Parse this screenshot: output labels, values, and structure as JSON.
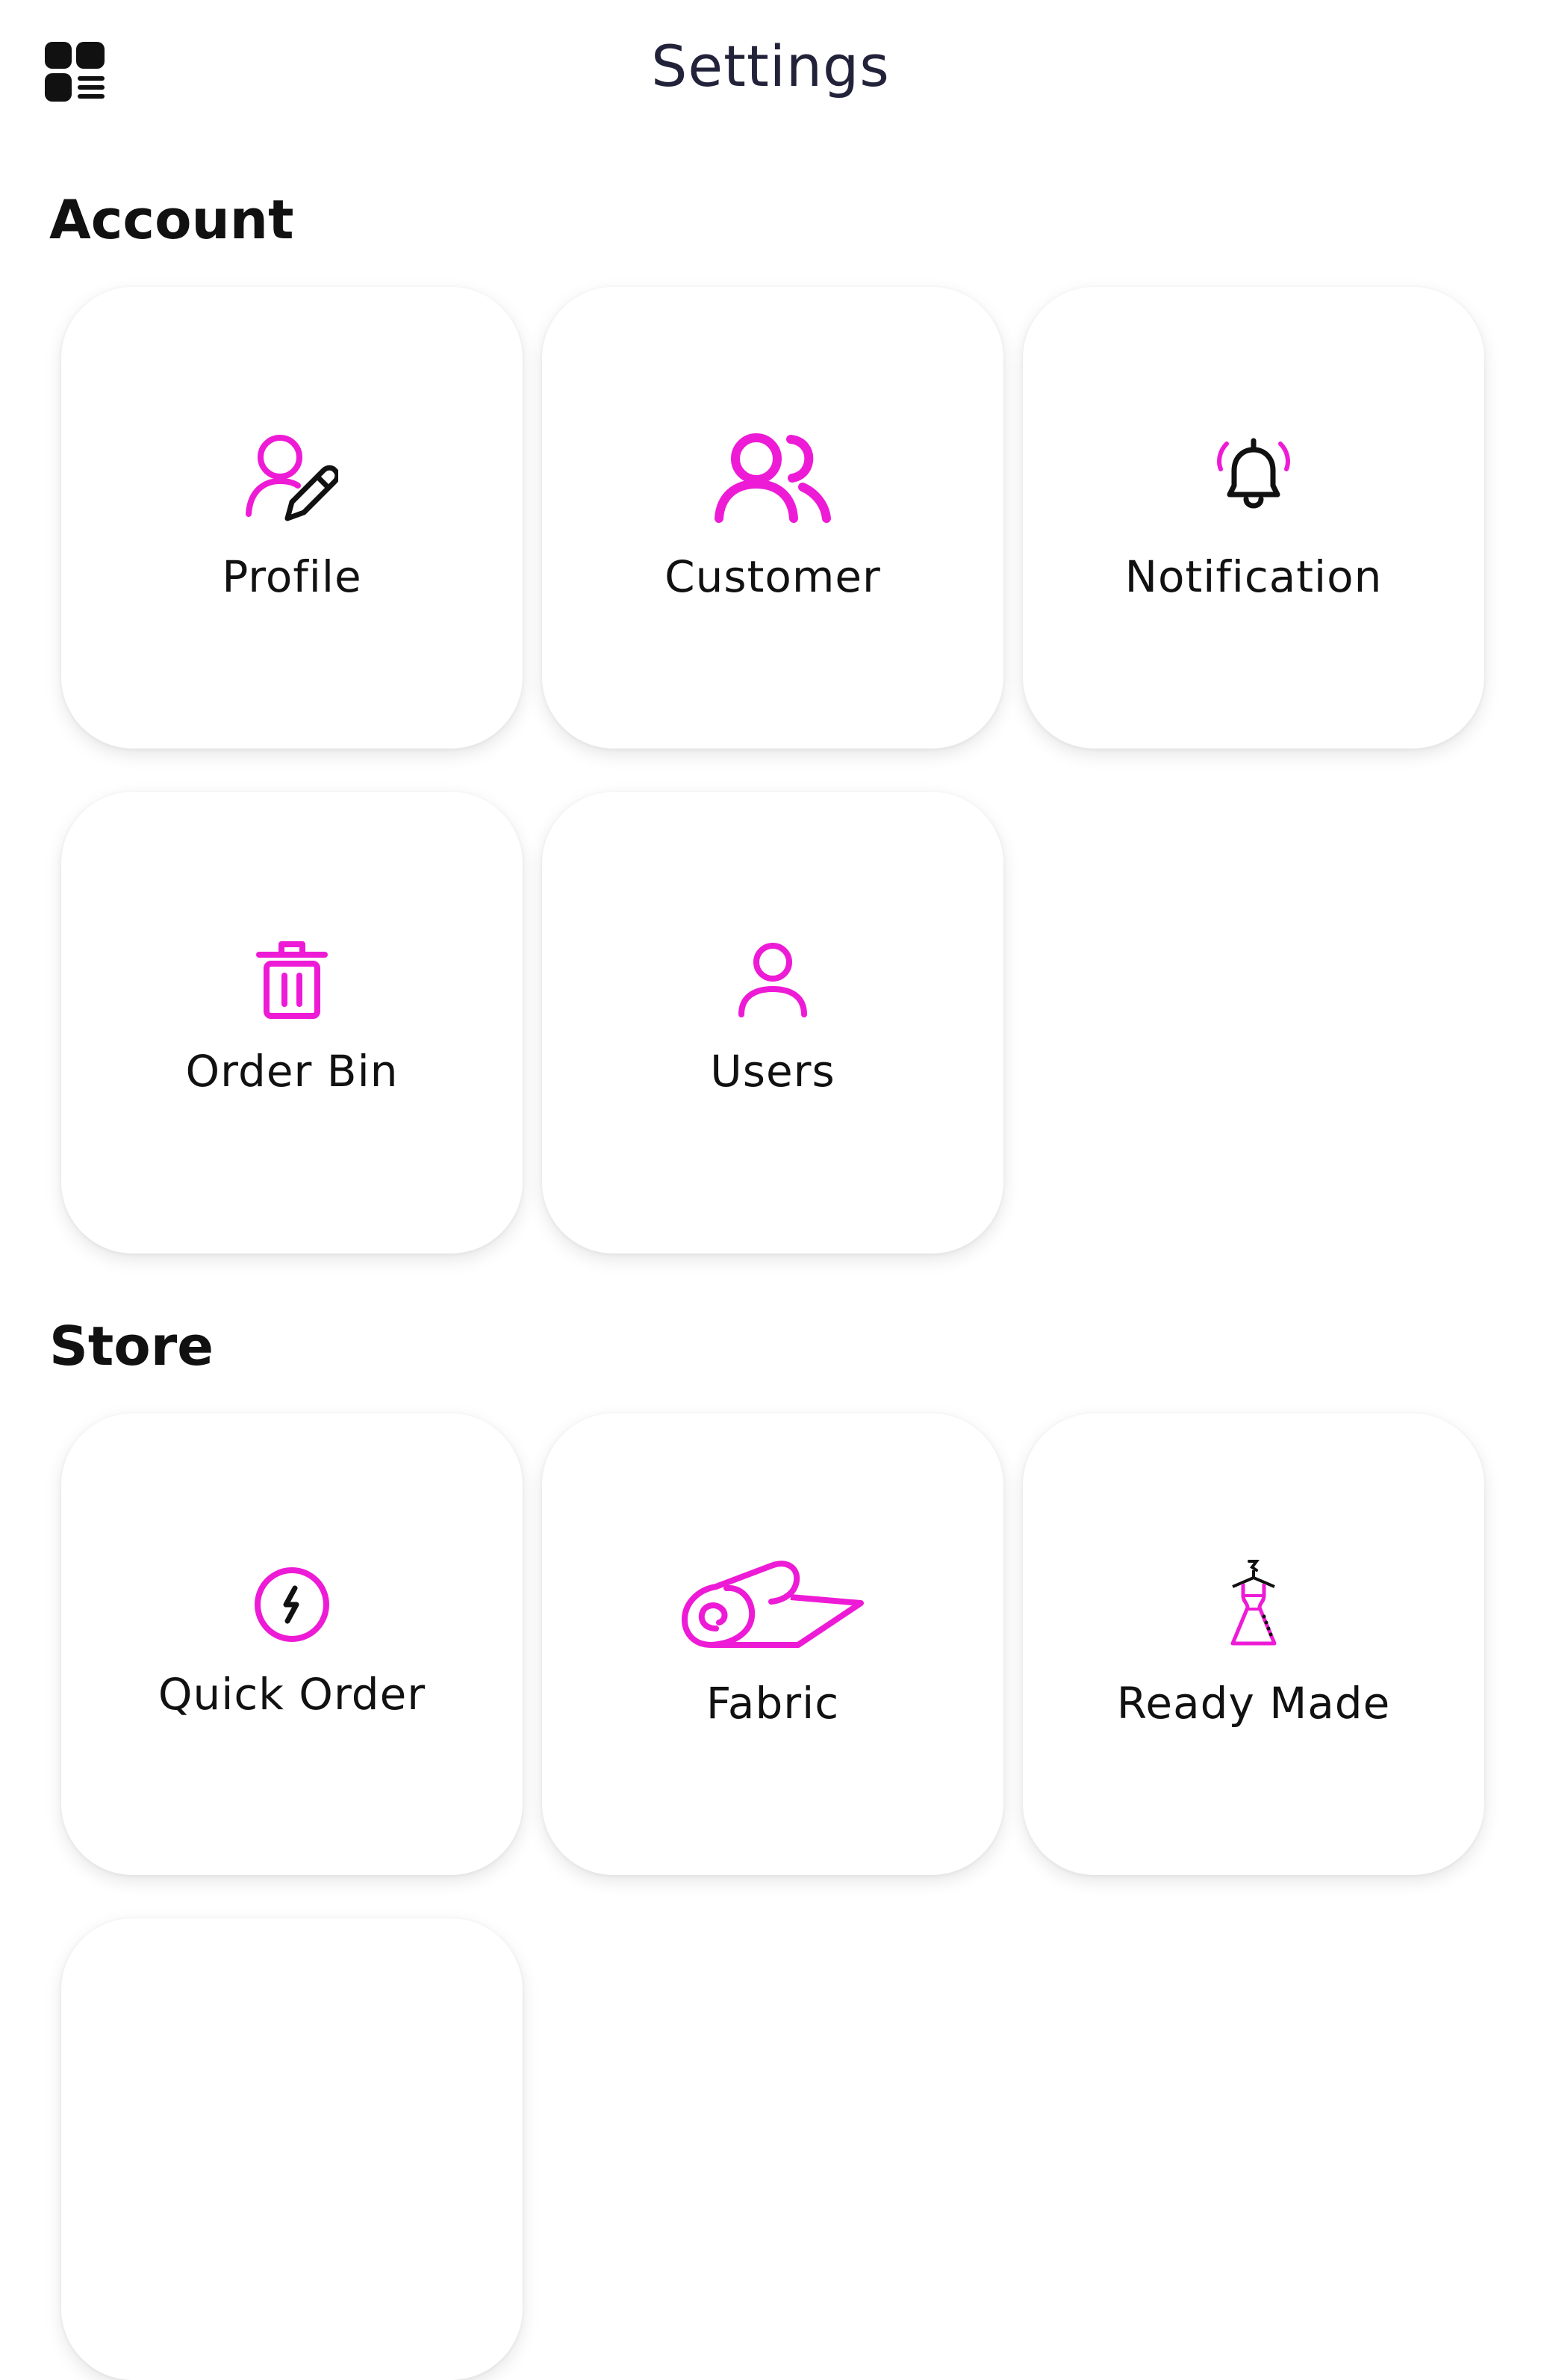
{
  "header": {
    "title": "Settings",
    "menu_icon": "grid-list-icon"
  },
  "colors": {
    "accent": "#ee1bd6",
    "icon_dark": "#111111",
    "title": "#22223a"
  },
  "sections": [
    {
      "title": "Account",
      "items": [
        {
          "label": "Profile",
          "icon": "user-edit-icon"
        },
        {
          "label": "Customer",
          "icon": "users-group-icon"
        },
        {
          "label": "Notification",
          "icon": "bell-ringing-icon"
        },
        {
          "label": "Order Bin",
          "icon": "trash-icon"
        },
        {
          "label": "Users",
          "icon": "user-icon"
        }
      ]
    },
    {
      "title": "Store",
      "items": [
        {
          "label": "Quick Order",
          "icon": "lightning-circle-icon"
        },
        {
          "label": "Fabric",
          "icon": "fabric-roll-icon"
        },
        {
          "label": "Ready Made",
          "icon": "dress-hanger-icon"
        },
        {
          "label": "",
          "icon": ""
        }
      ]
    }
  ]
}
